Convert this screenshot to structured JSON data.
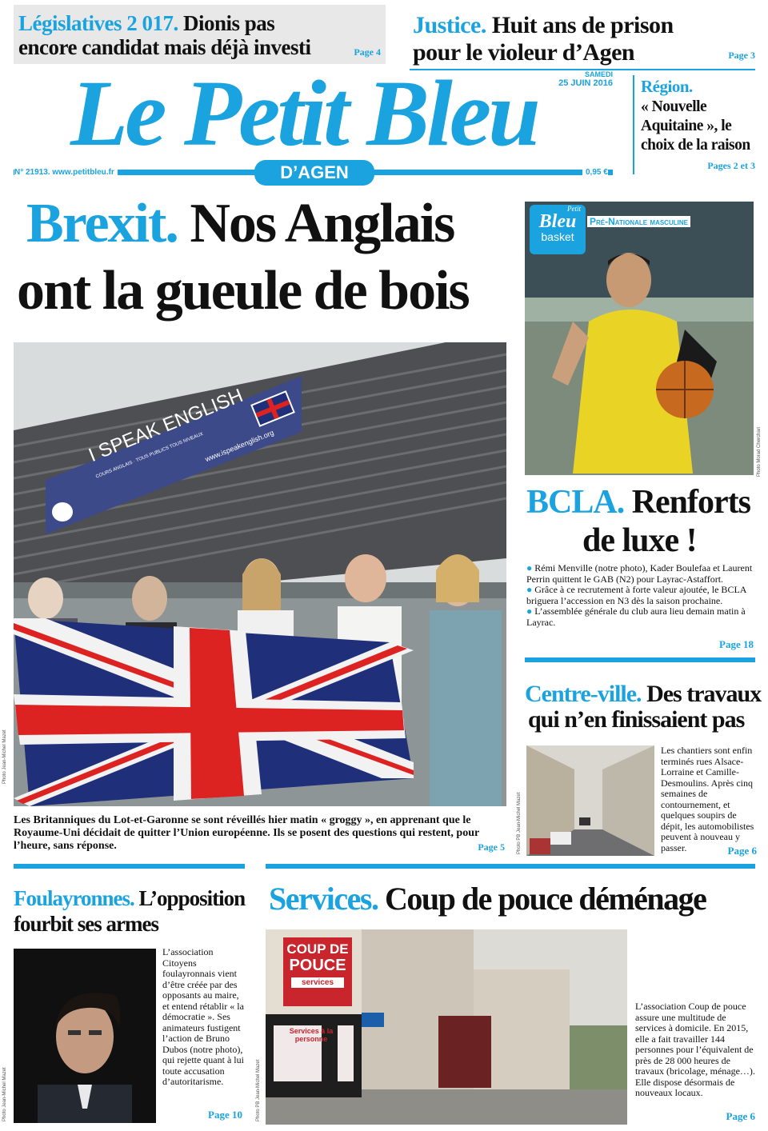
{
  "top_left": {
    "kicker": "Législatives 2 017.",
    "title_rest": "Dionis pas",
    "title_line2": "encore candidat mais déjà investi",
    "page": "Page 4"
  },
  "top_right": {
    "kicker": "Justice.",
    "title_rest": "Huit ans de prison",
    "title_line2": "pour le violeur d’Agen",
    "page": "Page 3"
  },
  "masthead": {
    "title": "Le Petit Bleu",
    "day": "SAMEDI",
    "date": "25 JUIN 2016",
    "edition": "D’AGEN",
    "issue": "N° 21913. www.petitbleu.fr",
    "price": "0,95 €"
  },
  "region": {
    "kicker": "Région.",
    "text": "« Nouvelle Aquitaine », le choix de la raison",
    "page": "Pages 2 et 3"
  },
  "lead": {
    "kicker": "Brexit.",
    "title_rest": "Nos Anglais",
    "title_line2": "ont la gueule de bois",
    "banner_text": "I SPEAK ENGLISH",
    "banner_url": "www.ispeakenglish.org",
    "banner_sub": "COURS ANGLAIS · TOUS PUBLICS TOUS NIVEAUX",
    "caption": "Les Britanniques du Lot-et-Garonne se sont réveillés hier matin « groggy », en apprenant que le Royaume-Uni décidait de quitter l’Union européenne. Ils se posent des questions qui restent, pour l’heure, sans réponse.",
    "page": "Page 5",
    "credit": "Photo Jean-Michel Mazet"
  },
  "basket": {
    "logo_top": "Petit",
    "logo_mid": "Bleu",
    "logo_bottom": "basket",
    "section": "Pré-Nationale masculine",
    "kicker": "BCLA.",
    "title_rest": "Renforts",
    "title_line2": "de luxe !",
    "bullets": [
      "Rémi Menville (notre photo), Kader Boulefaa et Laurent Perrin quittent le GAB (N2) pour Layrac-Astaffort.",
      "Grâce à ce recrutement à forte valeur ajoutée, le BCLA briguera l’accession en N3 dès la saison prochaine.",
      "L’assemblée générale du club aura lieu demain matin à Layrac."
    ],
    "page": "Page 18",
    "credit": "Photo Morad Cherchari"
  },
  "centre_ville": {
    "kicker": "Centre-ville.",
    "title_rest": "Des travaux",
    "title_line2": "qui n’en finissaient pas",
    "text": "Les chantiers sont enfin terminés rues Alsace-Lorraine et Camille-Desmoulins. Après cinq semaines de contournement, et quelques soupirs de dépit, les automobilistes peuvent à nouveau y passer.",
    "page": "Page 6",
    "credit": "Photo PB Jean-Michel Mazet"
  },
  "foulayronnes": {
    "kicker": "Foulayronnes.",
    "title_rest": "L’opposition",
    "title_line2": "fourbit ses armes",
    "text": "L’association Citoyens foulayronnais vient d’être créée par des opposants au maire, et entend rétablir « la démocratie ». Ses animateurs fustigent l’action de Bruno Dubos (notre photo), qui rejette quant à lui toute accusation d’autoritarisme.",
    "page": "Page 10",
    "credit": "Photo Jean-Michel Mazet"
  },
  "services": {
    "kicker": "Services.",
    "title_rest": "Coup de pouce déménage",
    "shop_sign_1": "COUP DE",
    "shop_sign_2": "POUCE",
    "shop_sign_3": "services",
    "window_text": "Services à la personne",
    "text": "L’association Coup de pouce assure une multitude de services à domicile. En 2015, elle a fait travailler 144 personnes pour l’équivalent de près de 28 000 heures de travaux (bricolage, ménage…). Elle dispose désormais de nouveaux locaux.",
    "page": "Page 6",
    "credit": "Photo PB Jean-Michel Mazet"
  }
}
